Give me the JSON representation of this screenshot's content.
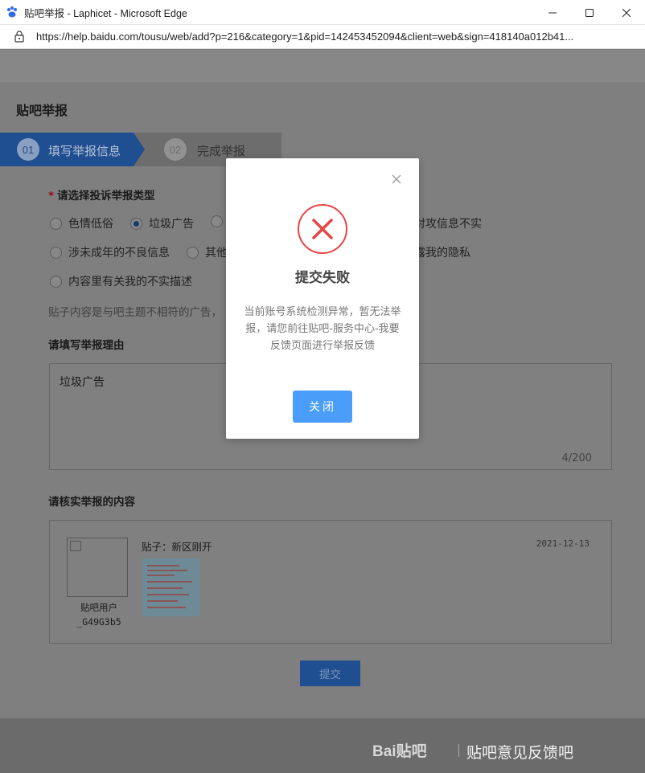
{
  "window": {
    "title": "贴吧举报 - Laphicet - Microsoft Edge",
    "url": "https://help.baidu.com/tousu/web/add?p=216&category=1&pid=142453452094&client=web&sign=418140a012b41..."
  },
  "page": {
    "title": "贴吧举报",
    "steps": [
      {
        "num": "01",
        "label": "填写举报信息",
        "active": true
      },
      {
        "num": "02",
        "label": "完成举报",
        "active": false
      }
    ],
    "type_question": {
      "required_mark": "*",
      "label": "请选择投诉举报类型",
      "options": [
        {
          "label": "色情低俗",
          "selected": false
        },
        {
          "label": "垃圾广告",
          "selected": true
        },
        {
          "label": "对攻信息不实",
          "selected": false
        },
        {
          "label": "涉未成年的不良信息",
          "selected": false
        },
        {
          "label": "其他",
          "selected": false
        },
        {
          "label": "露我的隐私",
          "selected": false
        },
        {
          "label": "内容里有关我的不实描述",
          "selected": false
        }
      ],
      "hint": "贴子内容是与吧主题不相符的广告，"
    },
    "reason": {
      "label": "请填写举报理由",
      "value": "垃圾广告",
      "counter": "4/200"
    },
    "verify": {
      "label": "请核实举报的内容",
      "username": "贴吧用户_G49G3b5",
      "post_title": "贴子：新区刚开",
      "date": "2021-12-13"
    },
    "submit_label": "提交"
  },
  "footer": {
    "logo_text": "Bai贴吧",
    "feedback": "贴吧意见反馈吧"
  },
  "dialog": {
    "title": "提交失败",
    "message": "当前账号系统检测异常，暂无法举报，请您前往贴吧-服务中心-我要反馈页面进行举报反馈",
    "button": "关闭"
  },
  "colors": {
    "accent": "#4a9df8",
    "error": "#e84545",
    "step_active": "#1f4e91"
  },
  "icons": [
    "baidu-paw-icon",
    "minimize-icon",
    "maximize-icon",
    "close-icon",
    "lock-icon",
    "error-x-icon",
    "dialog-close-icon"
  ]
}
